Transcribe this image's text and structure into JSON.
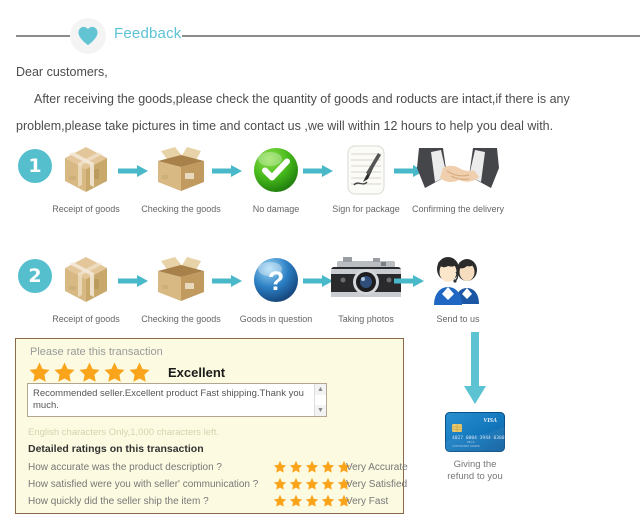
{
  "header": {
    "title": "Feedback",
    "heart_icon": "heart-icon",
    "accent_color": "#5cc3d4"
  },
  "intro": {
    "greeting": "Dear customers,",
    "line1": "After receiving the goods,please check the quantity of goods and roducts are intact,if there is any",
    "line2": "problem,please take pictures in time and contact us ,we will within 12 hours to help you deal with."
  },
  "steps": [
    {
      "number": "1",
      "nodes": [
        {
          "caption": "Receipt of goods",
          "icon": "closed-box-icon"
        },
        {
          "caption": "Checking the goods",
          "icon": "open-box-icon"
        },
        {
          "caption": "No damage",
          "icon": "green-check-icon"
        },
        {
          "caption": "Sign for package",
          "icon": "signature-note-icon"
        },
        {
          "caption": "Confirming the delivery",
          "icon": "handshake-icon"
        }
      ]
    },
    {
      "number": "2",
      "nodes": [
        {
          "caption": "Receipt of goods",
          "icon": "closed-box-icon"
        },
        {
          "caption": "Checking the goods",
          "icon": "open-box-icon"
        },
        {
          "caption": "Goods in question",
          "icon": "blue-question-icon"
        },
        {
          "caption": "Taking photos",
          "icon": "camera-icon"
        },
        {
          "caption": "Send to us",
          "icon": "support-agents-icon"
        }
      ]
    }
  ],
  "rating_card": {
    "prompt": "Please rate this transaction",
    "overall_stars": 5,
    "overall_label": "Excellent",
    "comment": "Recommended seller.Excellent product Fast shipping.Thank you much.",
    "char_note": "English characters Only,1,000 characters left.",
    "detail_title": "Detailed ratings on this transaction",
    "detail_rows": [
      {
        "question": "How accurate was the product description ?",
        "stars": 5,
        "value": "Very Accurate"
      },
      {
        "question": "How satisfied were you with seller' communication  ?",
        "stars": 5,
        "value": "Very Satisfied"
      },
      {
        "question": "How quickly did the seller ship the item ?",
        "stars": 5,
        "value": "Very Fast"
      }
    ],
    "star_color": "#f7a51c",
    "background_color": "#fcfbe1",
    "border_color": "#8a6a4a"
  },
  "refund": {
    "arrow_icon": "down-arrow-icon",
    "card_icon": "visa-credit-card-icon",
    "card_brand": "VISA",
    "caption_line1": "Giving the",
    "caption_line2": "refund to you"
  }
}
